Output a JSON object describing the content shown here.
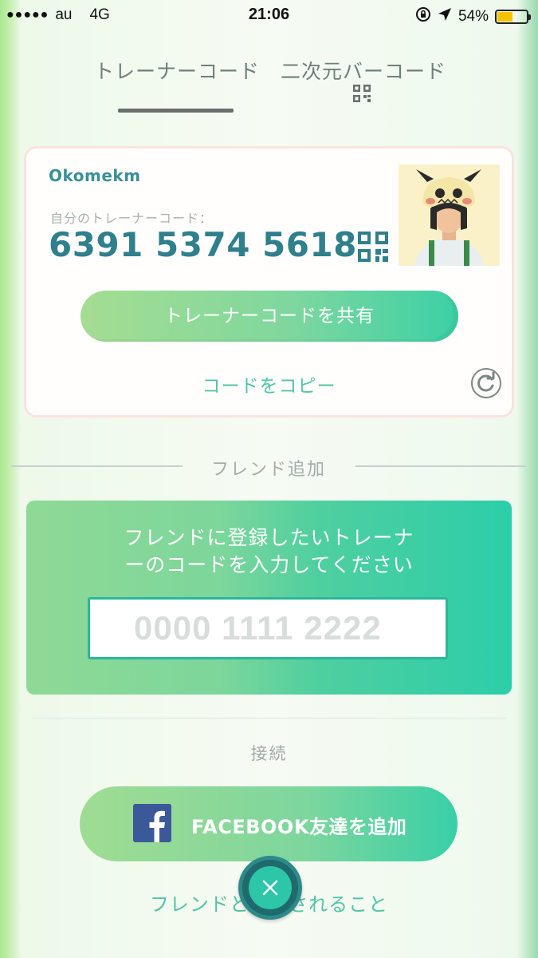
{
  "status_bar": {
    "signal_dots": "●●●●●",
    "carrier": "au",
    "network": "4G",
    "time": "21:06",
    "battery_percent": "54%",
    "battery_level": 0.54,
    "battery_color": "#f5c400"
  },
  "tabs": [
    {
      "label": "トレーナーコード",
      "active": true
    },
    {
      "label": "二次元バーコード",
      "active": false
    }
  ],
  "trainer_card": {
    "name": "Okomekm",
    "code_label": "自分のトレーナーコード：",
    "code": "6391 5374 5618",
    "share_button": "トレーナーコードを共有",
    "copy_link": "コードをコピー"
  },
  "add_friend": {
    "section_title": "フレンド追加",
    "prompt_line1": "フレンドに登録したいトレーナ",
    "prompt_line2": "ーのコードを入力してください",
    "input_value": "",
    "input_placeholder": "0000 1111 2222"
  },
  "connect": {
    "label": "接続",
    "facebook_button": "FACEBOOK友達を追加",
    "facebook_color": "#3b5998",
    "friend_info_link": "フレンドとしてされること"
  },
  "colors": {
    "accent_teal": "#2ec6a8",
    "code_text": "#2f7f8c"
  }
}
